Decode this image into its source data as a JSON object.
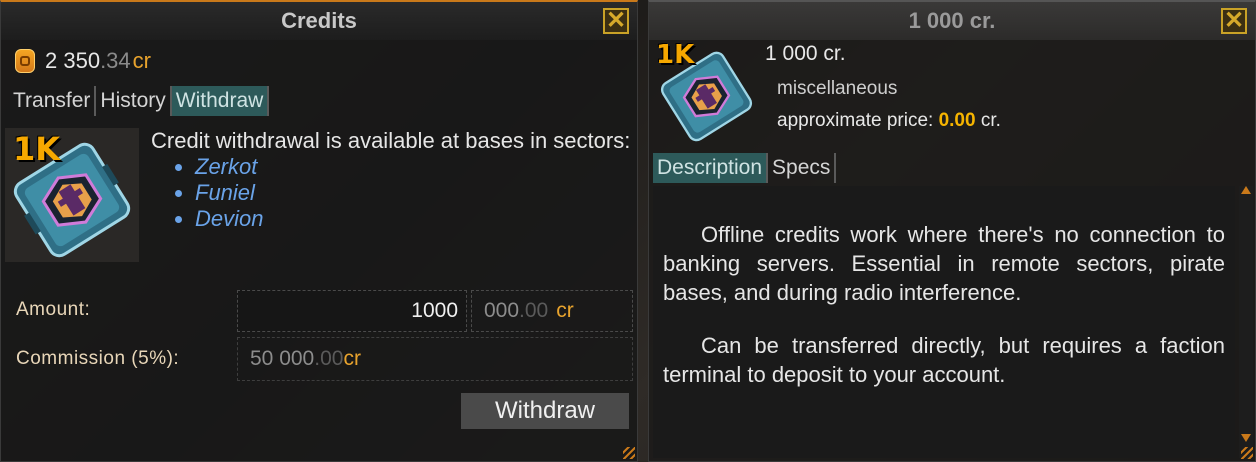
{
  "credits_window": {
    "title": "Credits",
    "balance": {
      "integer": "2 350",
      "decimal": ".34",
      "currency": "cr"
    },
    "tabs": [
      {
        "label": "Transfer",
        "active": false
      },
      {
        "label": "History",
        "active": false
      },
      {
        "label": "Withdraw",
        "active": true
      }
    ],
    "item_badge": "1K",
    "info": {
      "text": "Credit withdrawal is available at bases in sectors:",
      "sectors": [
        "Zerkot",
        "Funiel",
        "Devion"
      ]
    },
    "form": {
      "amount_label": "Amount:",
      "amount_value": "1000",
      "amount_total_main": "000",
      "amount_total_dec": ".00",
      "amount_total_currency": "cr",
      "commission_label": "Commission (5%):",
      "commission_main": "50 000",
      "commission_dec": ".00",
      "commission_currency": "cr"
    },
    "withdraw_button": "Withdraw"
  },
  "item_window": {
    "title": "1 000 cr.",
    "item_badge": "1K",
    "item_name": "1 000 cr.",
    "category": "miscellaneous",
    "price_label": "approximate price:",
    "price_value": "0.00",
    "price_currency": "cr.",
    "tabs": [
      {
        "label": "Description",
        "active": true
      },
      {
        "label": "Specs",
        "active": false
      }
    ],
    "description": [
      "Offline credits work where there's no connection to banking servers. Essential in remote sectors, pirate bases, and during radio interference.",
      "Can be transferred directly, but requires a faction terminal to deposit to your account."
    ]
  },
  "colors": {
    "accent": "#c9791a",
    "currency": "#e8a32d",
    "link": "#6aa3e8",
    "tab_active": "#2d5a5a"
  },
  "icons": [
    "close-icon",
    "coin-icon",
    "credit-chip-icon",
    "scroll-up-icon",
    "scroll-down-icon",
    "resize-grip-icon"
  ]
}
